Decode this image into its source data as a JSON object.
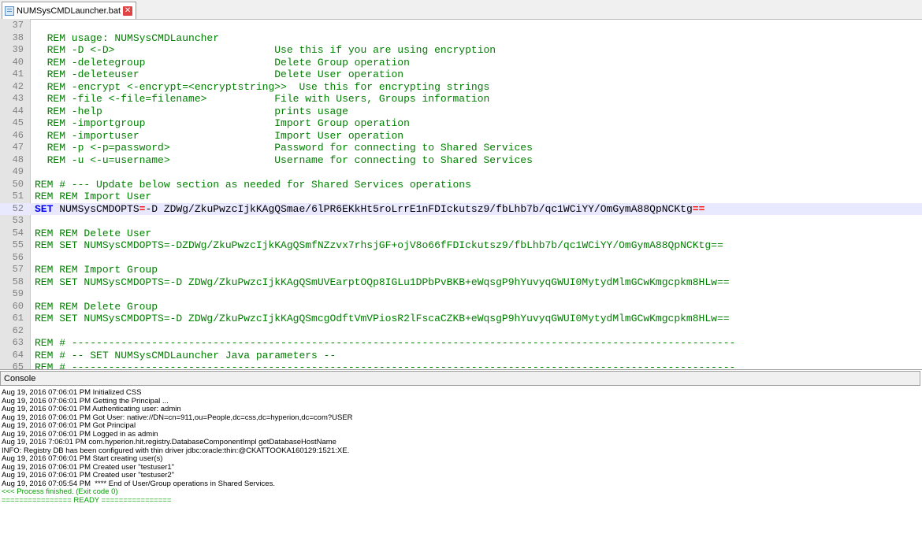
{
  "tab": {
    "label": "NUMSysCMDLauncher.bat",
    "close": "✕"
  },
  "editor": {
    "lines": [
      {
        "n": "37",
        "t": ""
      },
      {
        "n": "38",
        "t": "  REM usage: NUMSysCMDLauncher"
      },
      {
        "n": "39",
        "t": "  REM -D <-D>                          Use this if you are using encryption"
      },
      {
        "n": "40",
        "t": "  REM -deletegroup                     Delete Group operation"
      },
      {
        "n": "41",
        "t": "  REM -deleteuser                      Delete User operation"
      },
      {
        "n": "42",
        "t": "  REM -encrypt <-encrypt=<encryptstring>>  Use this for encrypting strings"
      },
      {
        "n": "43",
        "t": "  REM -file <-file=filename>           File with Users, Groups information"
      },
      {
        "n": "44",
        "t": "  REM -help                            prints usage"
      },
      {
        "n": "45",
        "t": "  REM -importgroup                     Import Group operation"
      },
      {
        "n": "46",
        "t": "  REM -importuser                      Import User operation"
      },
      {
        "n": "47",
        "t": "  REM -p <-p=password>                 Password for connecting to Shared Services"
      },
      {
        "n": "48",
        "t": "  REM -u <-u=username>                 Username for connecting to Shared Services"
      },
      {
        "n": "49",
        "t": ""
      },
      {
        "n": "50",
        "t": "REM # --- Update below section as needed for Shared Services operations"
      },
      {
        "n": "51",
        "t": "REM REM Import User"
      },
      {
        "n": "52",
        "t": "SET NUMSysCMDOPTS=-D ZDWg/ZkuPwzcIjkKAgQSmae/6lPR6EKkHt5roLrrE1nFDIckutsz9/fbLhb7b/qc1WCiYY/OmGymA88QpNCKtg=="
      },
      {
        "n": "53",
        "t": ""
      },
      {
        "n": "54",
        "t": "REM REM Delete User"
      },
      {
        "n": "55",
        "t": "REM SET NUMSysCMDOPTS=-DZDWg/ZkuPwzcIjkKAgQSmfNZzvx7rhsjGF+ojV8o66fFDIckutsz9/fbLhb7b/qc1WCiYY/OmGymA88QpNCKtg=="
      },
      {
        "n": "56",
        "t": ""
      },
      {
        "n": "57",
        "t": "REM REM Import Group"
      },
      {
        "n": "58",
        "t": "REM SET NUMSysCMDOPTS=-D ZDWg/ZkuPwzcIjkKAgQSmUVEarptOQp8IGLu1DPbPvBKB+eWqsgP9hYuvyqGWUI0MytydMlmGCwKmgcpkm8HLw=="
      },
      {
        "n": "59",
        "t": ""
      },
      {
        "n": "60",
        "t": "REM REM Delete Group"
      },
      {
        "n": "61",
        "t": "REM SET NUMSysCMDOPTS=-D ZDWg/ZkuPwzcIjkKAgQSmcgOdftVmVPiosR2lFscaCZKB+eWqsgP9hYuvyqGWUI0MytydMlmGCwKmgcpkm8HLw=="
      },
      {
        "n": "62",
        "t": ""
      },
      {
        "n": "63",
        "t": "REM # ------------------------------------------------------------------------------------------------------------"
      },
      {
        "n": "64",
        "t": "REM # -- SET NUMSysCMDLauncher Java parameters --"
      },
      {
        "n": "65",
        "t": "REM # ------------------------------------------------------------------------------------------------------------"
      }
    ],
    "line52": {
      "kw": "SET",
      "var": " NUMSysCMDOPTS",
      "op": "=",
      "dash": "-D ZDWg/ZkuPwzcIjkKAgQSmae/6lPR6EKkHt5roLrrE1nFDIckutsz9/fbLhb7b/qc1WCiYY/OmGymA88QpNCKtg",
      "tail": "=="
    }
  },
  "console": {
    "title": "Console",
    "lines": [
      "Aug 19, 2016 07:06:01 PM Initialized CSS",
      "Aug 19, 2016 07:06:01 PM Getting the Principal ...",
      "Aug 19, 2016 07:06:01 PM Authenticating user: admin",
      "Aug 19, 2016 07:06:01 PM Got User: native://DN=cn=911,ou=People,dc=css,dc=hyperion,dc=com?USER",
      "Aug 19, 2016 07:06:01 PM Got Principal",
      "Aug 19, 2016 07:06:01 PM Logged in as admin",
      "Aug 19, 2016 7:06:01 PM com.hyperion.hit.registry.DatabaseComponentImpl getDatabaseHostName",
      "INFO: Registry DB has been configured with thin driver jdbc:oracle:thin:@CKATTOOKA160129:1521:XE.",
      "Aug 19, 2016 07:06:01 PM Start creating user(s)",
      "Aug 19, 2016 07:06:01 PM Created user \"testuser1\"",
      "Aug 19, 2016 07:06:01 PM Created user \"testuser2\"",
      "Aug 19, 2016 07:05:54 PM  **** End of User/Group operations in Shared Services."
    ],
    "status_lines": [
      "<<< Process finished. (Exit code 0)",
      "================ READY ================"
    ]
  }
}
